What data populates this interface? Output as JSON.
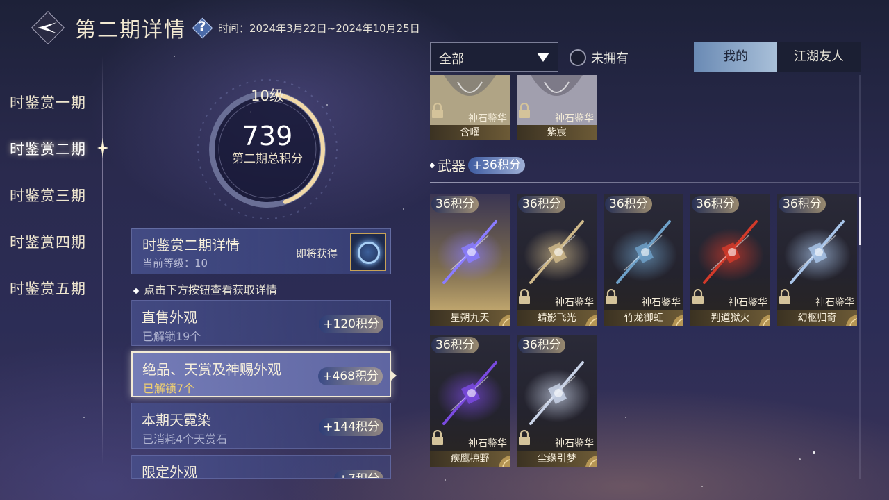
{
  "header": {
    "title": "第二期详情",
    "time": "时间：2024年3月22日~2024年10月25日"
  },
  "nav": {
    "items": [
      {
        "label": "时鉴赏一期",
        "active": false
      },
      {
        "label": "时鉴赏二期",
        "active": true
      },
      {
        "label": "时鉴赏三期",
        "active": false
      },
      {
        "label": "时鉴赏四期",
        "active": false
      },
      {
        "label": "时鉴赏五期",
        "active": false
      }
    ]
  },
  "score": {
    "level": "10级",
    "value": "739",
    "label": "第二期总积分",
    "ring_progress": 0.42
  },
  "detail": {
    "title": "时鉴赏二期详情",
    "current_level": "当前等级：10",
    "soon": "即将获得"
  },
  "hint": "点击下方按钮查看获取详情",
  "categories": [
    {
      "title": "直售外观",
      "sub": "已解锁19个",
      "points": "+120积分",
      "selected": false
    },
    {
      "title": "绝品、天赏及神赐外观",
      "sub": "已解锁7个",
      "points": "+468积分",
      "selected": true
    },
    {
      "title": "本期天霓染",
      "sub": "已消耗4个天赏石",
      "points": "+144积分",
      "selected": false
    },
    {
      "title": "限定外观",
      "sub": "",
      "points": "+7积分",
      "selected": false
    }
  ],
  "filter": {
    "selected": "全部",
    "unowned_label": "未拥有"
  },
  "tabs": [
    {
      "label": "我的",
      "active": true
    },
    {
      "label": "江湖友人",
      "active": false
    }
  ],
  "top_cards": [
    {
      "name": "含曜",
      "source": "神石鉴华"
    },
    {
      "name": "紫宸",
      "source": "神石鉴华"
    }
  ],
  "weapons": {
    "title": "武器",
    "points": "+36积分",
    "items": [
      {
        "name": "星朔九天",
        "points": "36积分",
        "source": "",
        "owned": true,
        "color": "#8a7cff"
      },
      {
        "name": "蜻影飞光",
        "points": "36积分",
        "source": "神石鉴华",
        "owned": false,
        "color": "#cfb98a"
      },
      {
        "name": "竹龙御虹",
        "points": "36积分",
        "source": "神石鉴华",
        "owned": false,
        "color": "#6ea0c8"
      },
      {
        "name": "判道狱火",
        "points": "36积分",
        "source": "神石鉴华",
        "owned": false,
        "color": "#d23a2a"
      },
      {
        "name": "幻枢归奇",
        "points": "36积分",
        "source": "神石鉴华",
        "owned": false,
        "color": "#a8c4e8"
      },
      {
        "name": "疾鹰掠野",
        "points": "36积分",
        "source": "神石鉴华",
        "owned": false,
        "color": "#7a4ae0"
      },
      {
        "name": "尘缘引梦",
        "points": "36积分",
        "source": "神石鉴华",
        "owned": false,
        "color": "#c8d2e6"
      }
    ]
  }
}
